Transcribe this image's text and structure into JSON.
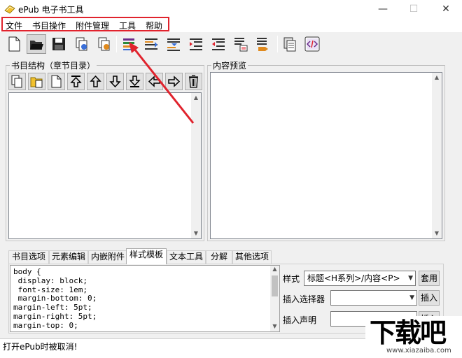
{
  "window": {
    "title": "ePub 电子书工具",
    "minimize": "—",
    "maximize": "☐",
    "close": "✕"
  },
  "menu": [
    "文件",
    "书目操作",
    "附件管理",
    "工具",
    "帮助"
  ],
  "toolbar_icons": [
    "new-file-icon",
    "open-folder-icon",
    "save-icon",
    "copy-book-icon",
    "paste-book-icon",
    "add-chapter-icon",
    "insert-before-icon",
    "insert-after-icon",
    "indent-icon",
    "outdent-icon",
    "split-icon",
    "merge-icon",
    "duplicate-icon",
    "html-source-icon"
  ],
  "left_panel": {
    "title": "书目结构（章节目录）",
    "buttons": [
      "copy-icon",
      "paste-icon",
      "new-item-icon",
      "move-top-icon",
      "move-up-icon",
      "move-down-icon",
      "move-bottom-icon",
      "move-left-icon",
      "move-right-icon",
      "delete-icon"
    ]
  },
  "right_panel": {
    "title": "内容预览"
  },
  "tabs": [
    "书目选项",
    "元素编辑",
    "内嵌附件",
    "样式模板",
    "文本工具",
    "分解",
    "其他选项"
  ],
  "active_tab": 3,
  "style_template": {
    "code": "body {\n display: block;\n font-size: 1em;\n margin-bottom: 0;\nmargin-left: 5pt;\nmargin-right: 5pt;\nmargin-top: 0;",
    "style_label": "样式",
    "style_value": "标题<H系列>/内容<P>",
    "apply_label": "套用",
    "selector_label": "插入选择器",
    "selector_value": "",
    "insert_label": "插入",
    "declaration_label": "插入声明",
    "declaration_value": "",
    "insert2_label": "插入"
  },
  "status": {
    "text": "打开ePub时被取消!"
  },
  "watermark": {
    "main": "下载吧",
    "sub": "www.xiazaiba.com"
  },
  "colors": {
    "highlight": "#e0232d",
    "arrow": "#e0232d"
  }
}
